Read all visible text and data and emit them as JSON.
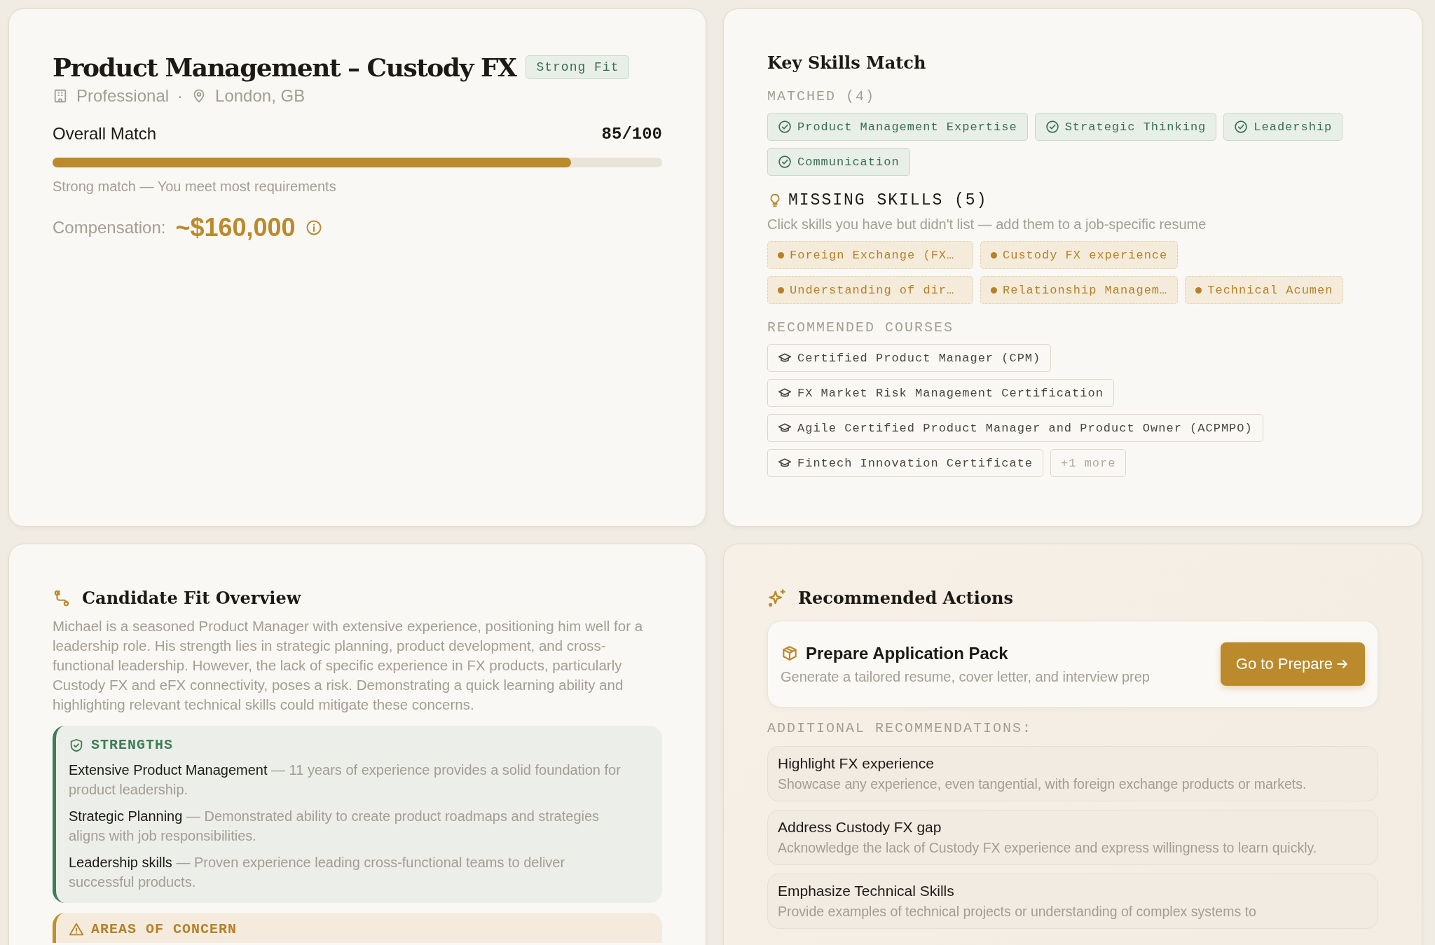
{
  "job": {
    "title": "Product Management – Custody FX",
    "badge": "Strong Fit",
    "level": "Professional",
    "separator": "·",
    "location": "London, GB",
    "match_label": "Overall Match",
    "score": "85/100",
    "match": {
      "level": 0.85
    },
    "match_note": "Strong match — You meet most requirements",
    "comp_label": "Compensation:",
    "comp_value": "~$160,000"
  },
  "skills": {
    "title": "Key Skills Match",
    "matched_label": "MATCHED (4)",
    "matched": [
      "Product Management Expertise",
      "Strategic Thinking",
      "Leadership",
      "Communication"
    ],
    "missing_label": "MISSING SKILLS (5)",
    "missing_hint": "Click skills you have but didn't list — add them to a job-specific resume",
    "missing": [
      "Foreign Exchange (FX…",
      "Custody FX experience",
      "Understanding of dir…",
      "Relationship Managem…",
      "Technical Acumen"
    ],
    "courses_label": "RECOMMENDED COURSES",
    "courses": [
      "Certified Product Manager (CPM)",
      "FX Market Risk Management Certification",
      "Agile Certified Product Manager and Product Owner (ACPMPO)",
      "Fintech Innovation Certificate"
    ],
    "more": "+1 more"
  },
  "overview": {
    "title": "Candidate Fit Overview",
    "summary": "Michael is a seasoned Product Manager with extensive experience, positioning him well for a leadership role. His strength lies in strategic planning, product development, and cross-functional leadership. However, the lack of specific experience in FX products, particularly Custody FX and eFX connectivity, poses a risk. Demonstrating a quick learning ability and highlighting relevant technical skills could mitigate these concerns.",
    "strengths_title": "STRENGTHS",
    "strengths": [
      {
        "text": "**Extensive Product Management** — 11 years of experience provides a solid foundation for product leadership."
      },
      {
        "text": "**Strategic Planning** — Demonstrated ability to create product roadmaps and strategies aligns with job responsibilities."
      },
      {
        "text": "**Leadership skills** — Proven experience leading cross-functional teams to deliver successful products."
      }
    ],
    "concern_title": "AREAS OF CONCERN"
  },
  "actions": {
    "title": "Recommended Actions",
    "pack_title": "Prepare Application Pack",
    "pack_desc": "Generate a tailored resume, cover letter, and interview prep",
    "pack_button": "Go to Prepare",
    "additional_label": "ADDITIONAL RECOMMENDATIONS:",
    "items": [
      {
        "title": "Highlight FX experience",
        "desc": "Showcase any experience, even tangential, with foreign exchange products or markets."
      },
      {
        "title": "Address Custody FX gap",
        "desc": "Acknowledge the lack of Custody FX experience and express willingness to learn quickly."
      },
      {
        "title": "Emphasize Technical Skills",
        "desc": "Provide examples of technical projects or understanding of complex systems to"
      }
    ]
  }
}
